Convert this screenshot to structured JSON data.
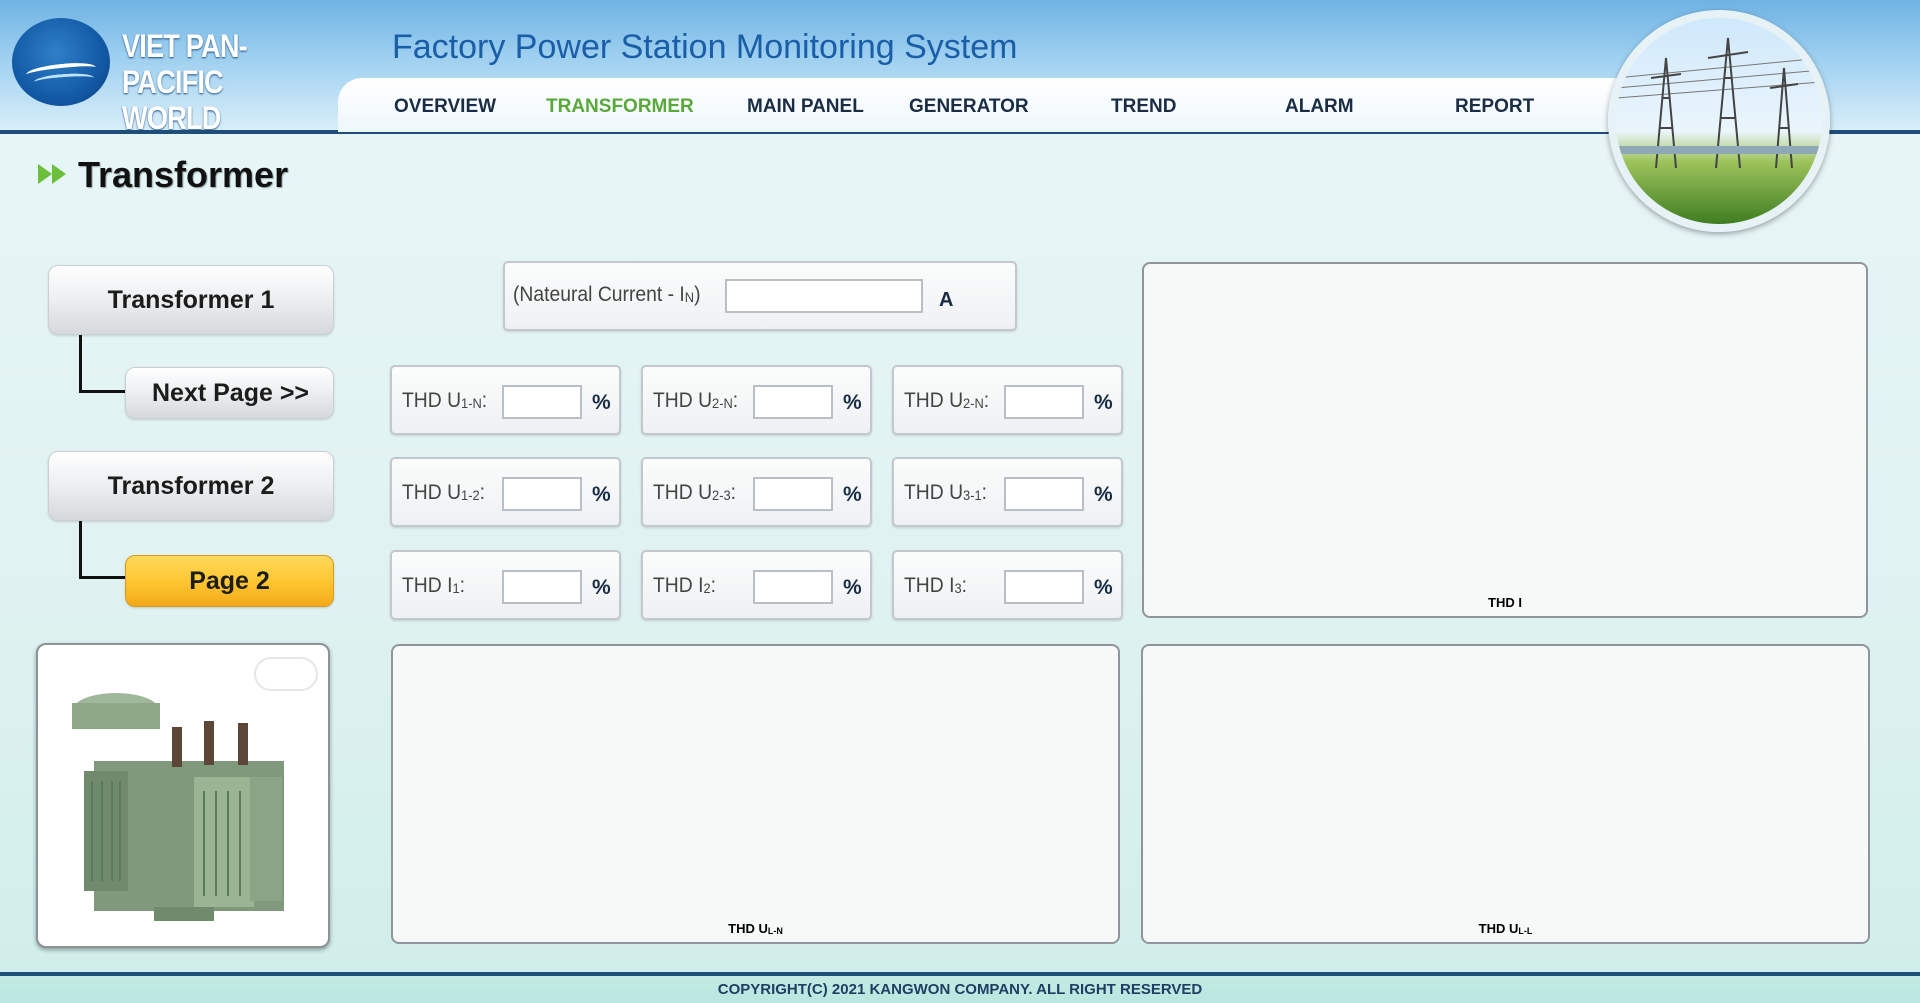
{
  "header": {
    "brand_line1": "VIET PAN-PACIFIC",
    "brand_line2": "WORLD",
    "app_title": "Factory Power Station Monitoring System"
  },
  "nav": {
    "items": [
      {
        "label": "OVERVIEW"
      },
      {
        "label": "TRANSFORMER"
      },
      {
        "label": "MAIN PANEL"
      },
      {
        "label": "GENERATOR"
      },
      {
        "label": "TREND"
      },
      {
        "label": "ALARM"
      },
      {
        "label": "REPORT"
      }
    ],
    "active": "TRANSFORMER"
  },
  "page": {
    "title": "Transformer"
  },
  "sidebar": {
    "transformer1": "Transformer 1",
    "next_page": "Next Page >>",
    "transformer2": "Transformer 2",
    "page2": "Page 2"
  },
  "neutral_current": {
    "label_main": "(Nateural Current - I",
    "label_sub": "N",
    "label_end": ")",
    "value": "",
    "unit": "A"
  },
  "thd_fields": [
    {
      "prefix": "THD U",
      "sub": "1-N",
      "suffix": ":",
      "value": "",
      "unit": "%"
    },
    {
      "prefix": "THD U",
      "sub": "2-N",
      "suffix": ":",
      "value": "",
      "unit": "%"
    },
    {
      "prefix": "THD U",
      "sub": "2-N",
      "suffix": ":",
      "value": "",
      "unit": "%"
    },
    {
      "prefix": "THD U",
      "sub": "1-2",
      "suffix": ":",
      "value": "",
      "unit": "%"
    },
    {
      "prefix": "THD U",
      "sub": "2-3",
      "suffix": ":",
      "value": "",
      "unit": "%"
    },
    {
      "prefix": "THD U",
      "sub": "3-1",
      "suffix": ":",
      "value": "",
      "unit": "%"
    },
    {
      "prefix": "THD I",
      "sub": "1",
      "suffix": ":",
      "value": "",
      "unit": "%"
    },
    {
      "prefix": "THD I",
      "sub": "2",
      "suffix": ":",
      "value": "",
      "unit": "%"
    },
    {
      "prefix": "THD I",
      "sub": "3",
      "suffix": ":",
      "value": "",
      "unit": "%"
    }
  ],
  "charts": {
    "thd_i": {
      "label": "THD I",
      "sub": ""
    },
    "thd_uln": {
      "label": "THD U",
      "sub": "L-N"
    },
    "thd_ull": {
      "label": "THD U",
      "sub": "L-L"
    }
  },
  "footer": {
    "copyright": "COPYRIGHT(C) 2021 KANGWON COMPANY. ALL RIGHT RESERVED"
  },
  "colors": {
    "header_dark": "#1d4f7a",
    "title_blue": "#1a5ea8",
    "nav_active": "#5aa83a",
    "page2_button": "#ffc733"
  }
}
